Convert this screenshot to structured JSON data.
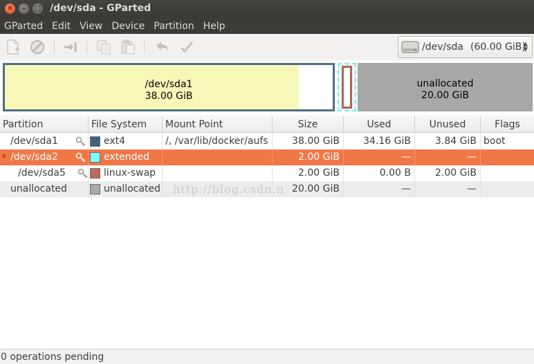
{
  "window": {
    "title": "/dev/sda - GParted"
  },
  "menu": [
    "GParted",
    "Edit",
    "View",
    "Device",
    "Partition",
    "Help"
  ],
  "toolbar": {
    "buttons": [
      "new-partition-icon",
      "delete-icon",
      "resize-move-icon",
      "copy-icon",
      "paste-icon",
      "undo-icon",
      "apply-icon"
    ],
    "device": {
      "name": "/dev/sda",
      "size": "(60.00 GiB)"
    }
  },
  "graphic": {
    "sda1": {
      "name": "/dev/sda1",
      "size": "38.00 GiB"
    },
    "unallocated": {
      "name": "unallocated",
      "size": "20.00 GiB"
    }
  },
  "table": {
    "headers": {
      "partition": "Partition",
      "filesystem": "File System",
      "mount": "Mount Point",
      "size": "Size",
      "used": "Used",
      "unused": "Unused",
      "flags": "Flags"
    },
    "rows": [
      {
        "partition": "/dev/sda1",
        "filesystem": "ext4",
        "fs_color": "#3f5f7f",
        "mount": "/, /var/lib/docker/aufs",
        "size": "38.00 GiB",
        "used": "34.16 GiB",
        "unused": "3.84 GiB",
        "flags": "boot"
      },
      {
        "partition": "/dev/sda2",
        "filesystem": "extended",
        "fs_color": "#7fffff",
        "mount": "",
        "size": "2.00 GiB",
        "used": "—",
        "unused": "—",
        "flags": ""
      },
      {
        "partition": "/dev/sda5",
        "filesystem": "linux-swap",
        "fs_color": "#c1665a",
        "mount": "",
        "size": "2.00 GiB",
        "used": "0.00 B",
        "unused": "2.00 GiB",
        "flags": ""
      },
      {
        "partition": "unallocated",
        "filesystem": "unallocated",
        "fs_color": "#a9a9a9",
        "mount": "",
        "size": "20.00 GiB",
        "used": "—",
        "unused": "—",
        "flags": ""
      }
    ]
  },
  "watermark": "http://blog.csdn.n",
  "status": {
    "text": "0 operations pending"
  }
}
